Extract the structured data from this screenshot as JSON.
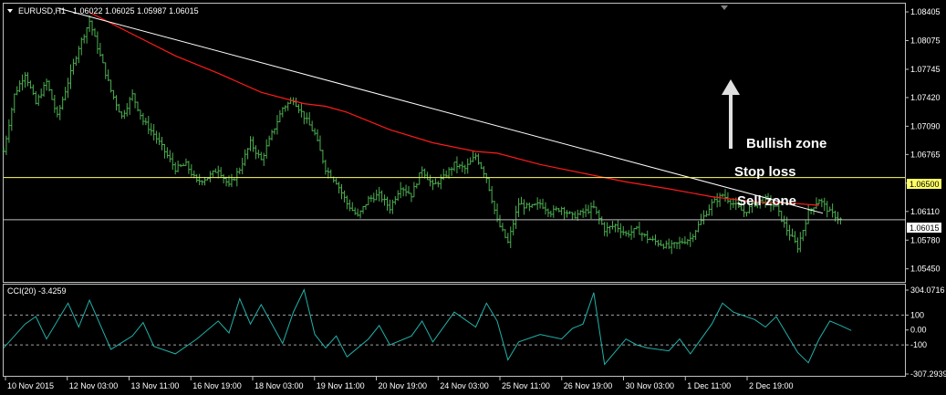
{
  "header": {
    "symbol_label": "EURUSD,H1",
    "ohlc_label": "1.06022 1.06025 1.05987 1.06015"
  },
  "indicator": {
    "label": "CCI(20) -3.4259"
  },
  "annotations": {
    "bullish": "Bullish zone",
    "stop_loss": "Stop loss",
    "sell_zone": "Sell zone"
  },
  "price_axis": {
    "ticks": [
      "1.08405",
      "1.08075",
      "1.07745",
      "1.07420",
      "1.07090",
      "1.06765",
      "1.06435",
      "1.06110",
      "1.05780",
      "1.05450"
    ],
    "stop_tag": "1.06500",
    "current_tag": "1.06015"
  },
  "cci_axis": {
    "ticks": [
      "304.0716",
      "100",
      "0.00",
      "-100",
      "-307.2939"
    ]
  },
  "time_axis": {
    "labels": [
      "10 Nov 2015",
      "12 Nov 03:00",
      "13 Nov 11:00",
      "16 Nov 19:00",
      "18 Nov 03:00",
      "19 Nov 11:00",
      "20 Nov 19:00",
      "24 Nov 03:00",
      "25 Nov 11:00",
      "26 Nov 19:00",
      "30 Nov 03:00",
      "1 Dec 11:00",
      "2 Dec 19:00"
    ]
  },
  "colors": {
    "background": "#000000",
    "bars": "#4caf50",
    "moving_average": "#ff1a1a",
    "trendline": "#ffffff",
    "stop_line": "#ffff66",
    "current_line": "#c0c0c0",
    "cci": "#20b2aa"
  },
  "chart_data": {
    "type": "ohlc",
    "symbol": "EURUSD",
    "timeframe": "H1",
    "x": [
      "10 Nov 2015",
      "12 Nov 03:00",
      "13 Nov 11:00",
      "16 Nov 19:00",
      "18 Nov 03:00",
      "19 Nov 11:00",
      "20 Nov 19:00",
      "24 Nov 03:00",
      "25 Nov 11:00",
      "26 Nov 19:00",
      "30 Nov 03:00",
      "1 Dec 11:00",
      "2 Dec 19:00"
    ],
    "close_path": [
      [
        0,
        1.068
      ],
      [
        0.5,
        1.0745
      ],
      [
        1,
        1.077
      ],
      [
        1.5,
        1.0735
      ],
      [
        2,
        1.076
      ],
      [
        2.5,
        1.072
      ],
      [
        3,
        1.076
      ],
      [
        3.5,
        1.08
      ],
      [
        4,
        1.083
      ],
      [
        4.5,
        1.079
      ],
      [
        5,
        1.075
      ],
      [
        5.5,
        1.072
      ],
      [
        6,
        1.0745
      ],
      [
        6.5,
        1.0715
      ],
      [
        7,
        1.07
      ],
      [
        7.5,
        1.068
      ],
      [
        8,
        1.066
      ],
      [
        8.5,
        1.0665
      ],
      [
        9,
        1.0645
      ],
      [
        9.5,
        1.065
      ],
      [
        10,
        1.066
      ],
      [
        10.5,
        1.064
      ],
      [
        11,
        1.066
      ],
      [
        11.5,
        1.069
      ],
      [
        12,
        1.067
      ],
      [
        12.5,
        1.07
      ],
      [
        13,
        1.073
      ],
      [
        13.5,
        1.074
      ],
      [
        14,
        1.072
      ],
      [
        14.5,
        1.07
      ],
      [
        15,
        1.066
      ],
      [
        15.5,
        1.0645
      ],
      [
        16,
        1.062
      ],
      [
        16.5,
        1.0605
      ],
      [
        17,
        1.0625
      ],
      [
        17.5,
        1.063
      ],
      [
        18,
        1.0615
      ],
      [
        18.5,
        1.064
      ],
      [
        19,
        1.063
      ],
      [
        19.5,
        1.066
      ],
      [
        20,
        1.064
      ],
      [
        20.5,
        1.065
      ],
      [
        21,
        1.0665
      ],
      [
        21.5,
        1.066
      ],
      [
        22,
        1.0675
      ],
      [
        22.5,
        1.065
      ],
      [
        23,
        1.06
      ],
      [
        23.5,
        1.0575
      ],
      [
        24,
        1.062
      ],
      [
        24.5,
        1.0615
      ],
      [
        25,
        1.062
      ],
      [
        25.5,
        1.061
      ],
      [
        26,
        1.0615
      ],
      [
        26.5,
        1.0605
      ],
      [
        27,
        1.061
      ],
      [
        27.5,
        1.0615
      ],
      [
        28,
        1.059
      ],
      [
        28.5,
        1.0595
      ],
      [
        29,
        1.0585
      ],
      [
        29.5,
        1.059
      ],
      [
        30,
        1.058
      ],
      [
        30.5,
        1.0575
      ],
      [
        31,
        1.057
      ],
      [
        31.5,
        1.0575
      ],
      [
        32,
        1.058
      ],
      [
        32.5,
        1.06
      ],
      [
        33,
        1.062
      ],
      [
        33.5,
        1.063
      ],
      [
        34,
        1.062
      ],
      [
        34.5,
        1.061
      ],
      [
        35,
        1.062
      ],
      [
        35.5,
        1.0625
      ],
      [
        36,
        1.0615
      ],
      [
        36.5,
        1.059
      ],
      [
        37,
        1.057
      ],
      [
        37.5,
        1.061
      ],
      [
        38,
        1.0625
      ],
      [
        38.5,
        1.061
      ],
      [
        39,
        1.06015
      ]
    ],
    "moving_average_path": [
      [
        4,
        1.084
      ],
      [
        6,
        1.0815
      ],
      [
        8,
        1.079
      ],
      [
        10,
        1.077
      ],
      [
        12,
        1.0748
      ],
      [
        14,
        1.0735
      ],
      [
        15,
        1.0732
      ],
      [
        16,
        1.0725
      ],
      [
        18,
        1.0705
      ],
      [
        20,
        1.069
      ],
      [
        22,
        1.068
      ],
      [
        23,
        1.0678
      ],
      [
        25,
        1.0665
      ],
      [
        27,
        1.0655
      ],
      [
        29,
        1.0645
      ],
      [
        31,
        1.0637
      ],
      [
        33,
        1.0628
      ],
      [
        35,
        1.0622
      ],
      [
        37,
        1.062
      ],
      [
        38,
        1.0618
      ]
    ],
    "trendline": {
      "from": [
        2.5,
        1.0845
      ],
      "to": [
        42,
        1.0609
      ]
    },
    "horizontal_lines": {
      "stop_loss": 1.065,
      "current": 1.06015
    },
    "ylim": [
      1.053,
      1.085
    ],
    "cci": {
      "name": "CCI(20)",
      "last": -3.4259,
      "ylim": [
        -307.2939,
        304.0716
      ],
      "levels": [
        100,
        -100
      ],
      "values": [
        [
          0,
          -120
        ],
        [
          1,
          40
        ],
        [
          1.5,
          90
        ],
        [
          2,
          -60
        ],
        [
          3,
          180
        ],
        [
          3.5,
          20
        ],
        [
          4,
          200
        ],
        [
          5,
          -130
        ],
        [
          6,
          -40
        ],
        [
          6.5,
          50
        ],
        [
          7,
          -110
        ],
        [
          8,
          -160
        ],
        [
          9,
          -60
        ],
        [
          10,
          60
        ],
        [
          10.5,
          -20
        ],
        [
          11,
          210
        ],
        [
          11.5,
          40
        ],
        [
          12,
          170
        ],
        [
          13,
          -90
        ],
        [
          13.5,
          120
        ],
        [
          14,
          270
        ],
        [
          14.5,
          -30
        ],
        [
          15,
          -120
        ],
        [
          15.5,
          -40
        ],
        [
          16,
          -180
        ],
        [
          17,
          -60
        ],
        [
          17.5,
          30
        ],
        [
          18,
          -100
        ],
        [
          19,
          -40
        ],
        [
          19.5,
          60
        ],
        [
          20,
          -80
        ],
        [
          21,
          120
        ],
        [
          22,
          20
        ],
        [
          22.5,
          180
        ],
        [
          23,
          60
        ],
        [
          23.5,
          -200
        ],
        [
          24,
          -80
        ],
        [
          25,
          -30
        ],
        [
          26,
          -60
        ],
        [
          26.5,
          10
        ],
        [
          27,
          40
        ],
        [
          27.5,
          250
        ],
        [
          28,
          -230
        ],
        [
          29,
          -60
        ],
        [
          29.5,
          -100
        ],
        [
          30,
          -120
        ],
        [
          31,
          -140
        ],
        [
          31.5,
          -60
        ],
        [
          32,
          -160
        ],
        [
          33,
          40
        ],
        [
          33.5,
          180
        ],
        [
          34,
          120
        ],
        [
          35,
          70
        ],
        [
          35.5,
          20
        ],
        [
          36,
          90
        ],
        [
          37,
          -150
        ],
        [
          37.5,
          -220
        ],
        [
          38,
          -60
        ],
        [
          38.5,
          60
        ],
        [
          39,
          30
        ],
        [
          39.5,
          -3.4259
        ]
      ]
    }
  }
}
